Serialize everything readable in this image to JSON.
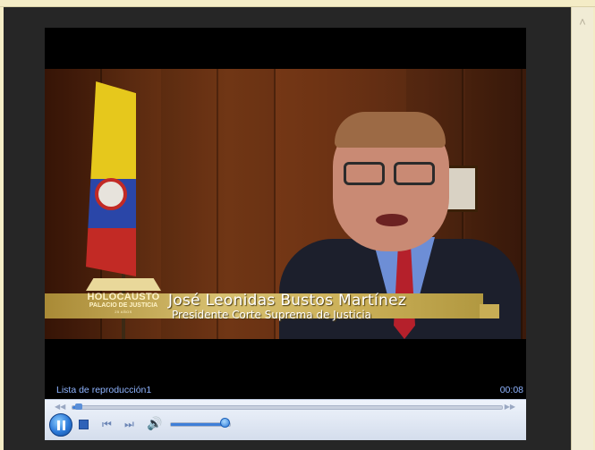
{
  "video": {
    "logo": {
      "line1": "HOLOCAUSTO",
      "line2": "PALACIO DE JUSTICIA",
      "line3": "25 AÑOS"
    },
    "caption_name": "José Leonidas Bustos Martínez",
    "caption_role": "Presidente Corte Suprema de Justicia"
  },
  "status": {
    "playlist": "Lista de reproducción1",
    "time": "00:08"
  },
  "seek": {
    "progress": 0.02
  },
  "volume": {
    "level": 0.88
  },
  "icons": {
    "scroll_up": "chevron-up-icon",
    "play_pause": "pause-icon",
    "stop": "stop-icon",
    "previous": "previous-icon",
    "next": "next-icon",
    "volume": "speaker-icon",
    "seek_back": "rewind-icon",
    "seek_forward": "fast-forward-icon"
  },
  "colors": {
    "status_text": "#8fb4ff",
    "accent": "#3e7fd8",
    "window_bg": "#262626",
    "page_bg": "#f4ecc6"
  }
}
